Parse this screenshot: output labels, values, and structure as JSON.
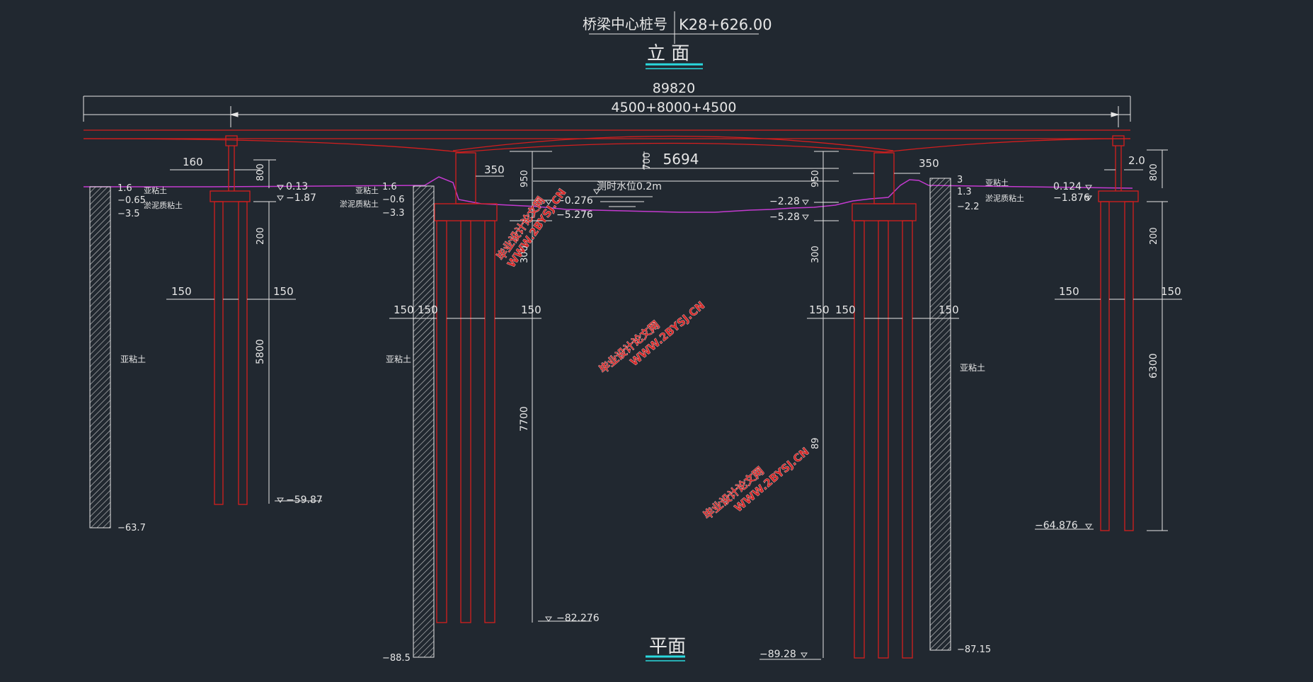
{
  "title": {
    "label": "桥梁中心桩号",
    "station": "K28+626.00"
  },
  "view_elevation": "立  面",
  "view_plan": "平面",
  "dims": {
    "total": "89820",
    "spans": "4500+8000+4500",
    "mid_clear": "5694",
    "a_160": "160",
    "a_800": "800",
    "a_200": "200",
    "a_150l": "150",
    "a_150r": "150",
    "a_5800": "5800",
    "b_350": "350",
    "b_950": "950",
    "b_700": "700",
    "b_300": "300",
    "b_150a": "150",
    "b_150b": "150",
    "b_150c": "150",
    "b_7700": "7700",
    "c_950": "950",
    "c_300": "300",
    "c_350": "350",
    "c_150a": "150",
    "c_150b": "150",
    "c_150c": "150",
    "c_89": "89",
    "d_20": "2.0",
    "d_800": "800",
    "d_200": "200",
    "d_150l": "150",
    "d_150r": "150",
    "d_6300": "6300"
  },
  "elev": {
    "a1": "0.13",
    "a2": "−1.87",
    "a_tip": "−59.87",
    "b1": "−0.276",
    "b2": "−5.276",
    "b_tip": "−82.276",
    "c1": "−2.28",
    "c2": "−5.28",
    "c_tip": "−89.28",
    "d1": "0.124",
    "d2": "−1.876",
    "d_tip": "−64.876"
  },
  "bore": {
    "b1": {
      "top": "1.6",
      "l2": "−0.65",
      "l3": "−3.5",
      "bottom": "−63.7",
      "s1": "亚粘土",
      "s2": "淤泥质粘土",
      "s3": "亚粘土"
    },
    "b2": {
      "top": "1.6",
      "l2": "−0.6",
      "l3": "−3.3",
      "bottom": "−88.5",
      "s1": "亚粘土",
      "s2": "淤泥质粘土",
      "s3": "亚粘土"
    },
    "b3": {
      "top": "3",
      "l2": "1.3",
      "l3": "−2.2",
      "bottom": "−87.15",
      "s1": "亚粘土",
      "s2": "淤泥质粘土",
      "s3": "亚粘土"
    }
  },
  "water": "测时水位0.2m",
  "watermark": {
    "line1": "毕业设计论文网",
    "line2": "WWW.2BYSJ.CN"
  },
  "colors": {
    "bg": "#212830",
    "structure": "#d41e1e",
    "ground": "#c43ad0",
    "line": "#e6e6e6",
    "accent": "#2ad9de"
  }
}
